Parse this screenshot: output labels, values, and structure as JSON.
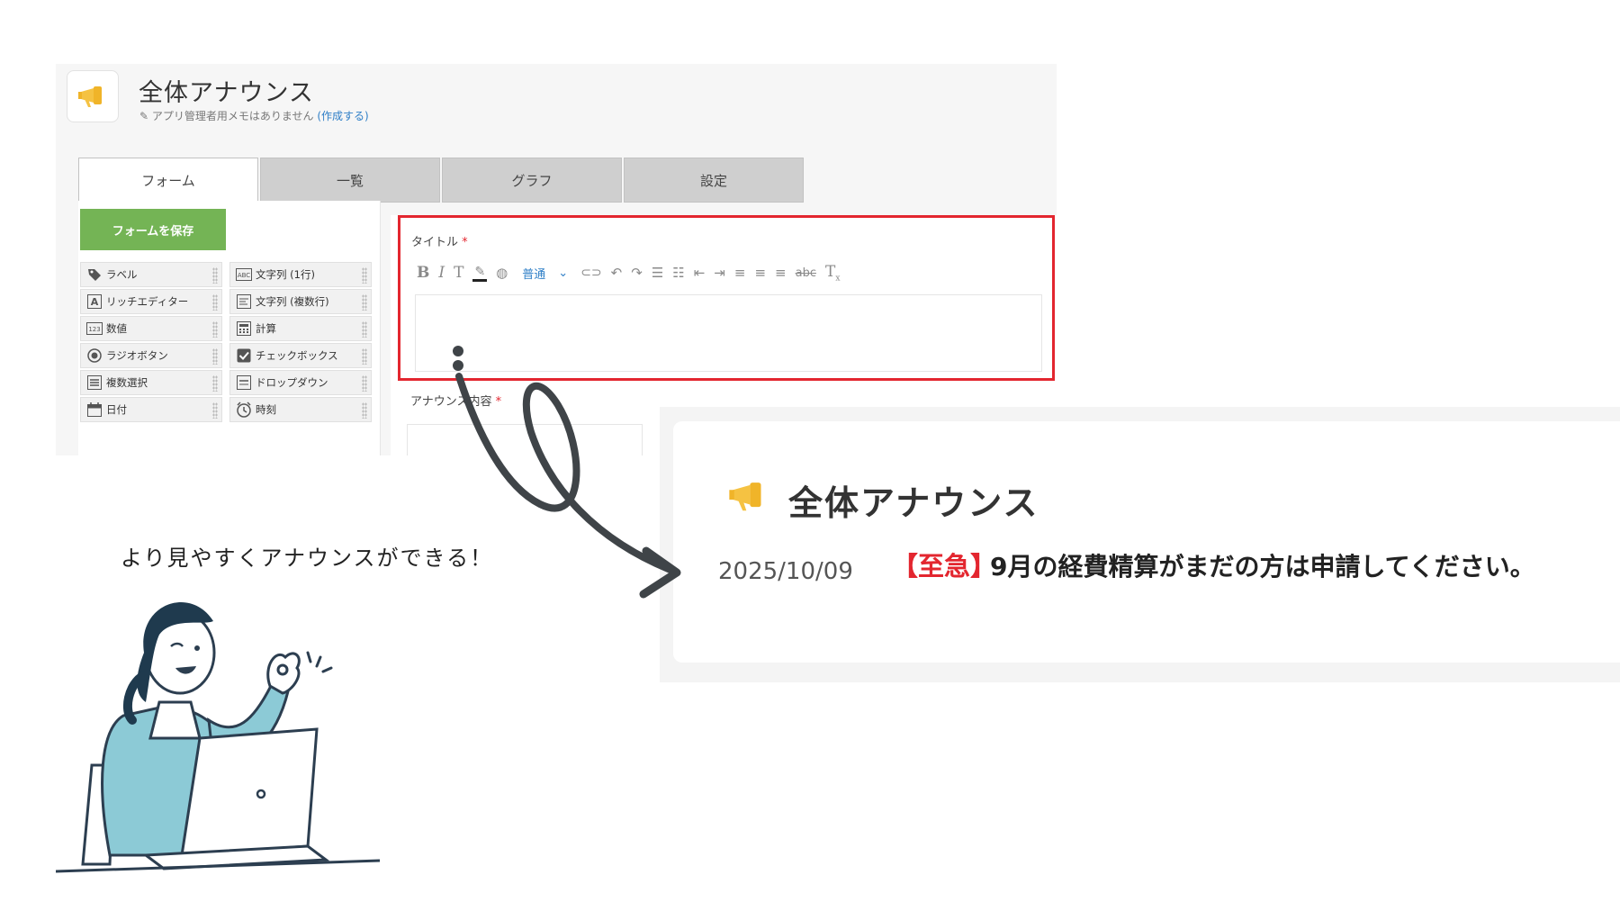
{
  "app": {
    "title": "全体アナウンス",
    "memo_text": "アプリ管理者用メモはありません",
    "memo_link": "(作成する)",
    "icon": "megaphone-icon"
  },
  "tabs": [
    {
      "label": "フォーム",
      "active": true
    },
    {
      "label": "一覧",
      "active": false
    },
    {
      "label": "グラフ",
      "active": false
    },
    {
      "label": "設定",
      "active": false
    }
  ],
  "toolbar": {
    "save_label": "フォームを保存"
  },
  "palette": [
    {
      "label": "ラベル",
      "icon": "tag-icon"
    },
    {
      "label": "文字列 (1行)",
      "icon": "abc-icon"
    },
    {
      "label": "リッチエディター",
      "icon": "rich-editor-icon"
    },
    {
      "label": "文字列 (複数行)",
      "icon": "multiline-icon"
    },
    {
      "label": "数値",
      "icon": "number-icon"
    },
    {
      "label": "計算",
      "icon": "calculator-icon"
    },
    {
      "label": "ラジオボタン",
      "icon": "radio-icon"
    },
    {
      "label": "チェックボックス",
      "icon": "checkbox-icon"
    },
    {
      "label": "複数選択",
      "icon": "multi-select-icon"
    },
    {
      "label": "ドロップダウン",
      "icon": "dropdown-icon"
    },
    {
      "label": "日付",
      "icon": "calendar-icon"
    },
    {
      "label": "時刻",
      "icon": "clock-icon"
    }
  ],
  "fields": {
    "title_label": "タイトル",
    "content_label": "アナウンス内容",
    "required_mark": "*"
  },
  "rich_editor": {
    "font_size": "普通"
  },
  "result": {
    "title": "全体アナウンス",
    "date": "2025/10/09",
    "urgent_tag": "【至急】",
    "message": "9月の経費精算がまだの方は申請してください。"
  },
  "caption": "より見やすくアナウンスができる！",
  "colors": {
    "accent_red": "#e3262f",
    "save_green": "#74b455",
    "link_blue": "#2f7fc7"
  }
}
